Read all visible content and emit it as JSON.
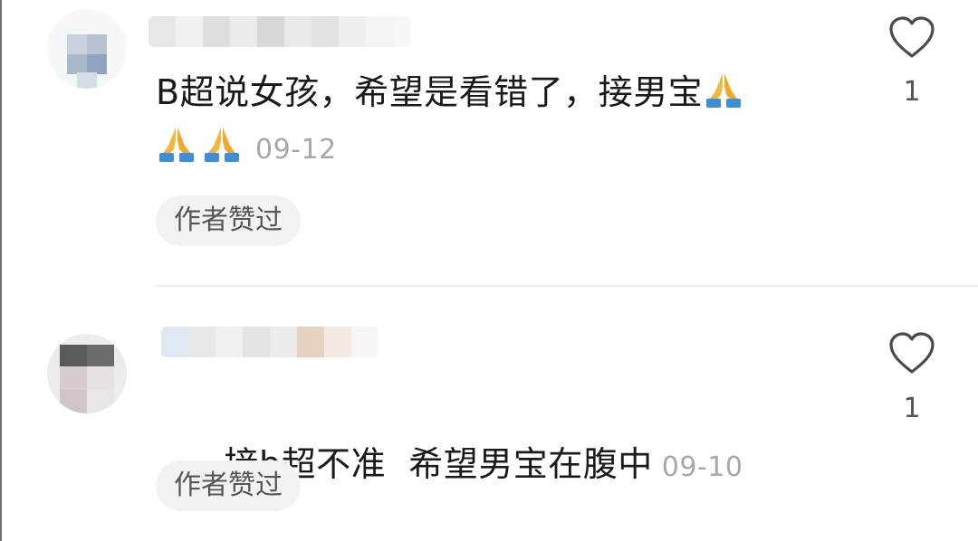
{
  "comments": [
    {
      "text_part1": "B超说女孩，希望是看错了，接男宝",
      "date": "09-12",
      "chip_label": "作者赞过",
      "like_count": "1",
      "icons": [
        "avatar-blurred",
        "username-blurred",
        "folded-hands-emoji",
        "heart-outline-icon"
      ]
    },
    {
      "text": "接b超不准  希望男宝在腹中",
      "date": "09-10",
      "chip_label": "作者赞过",
      "like_count": "1",
      "icons": [
        "avatar-blurred",
        "username-blurred",
        "heart-outline-icon"
      ]
    }
  ],
  "colors": {
    "text": "#1a1a1a",
    "date": "#a8a8a8",
    "chip_bg": "#f2f2f2",
    "chip_text": "#555555",
    "divider": "#ededed"
  }
}
